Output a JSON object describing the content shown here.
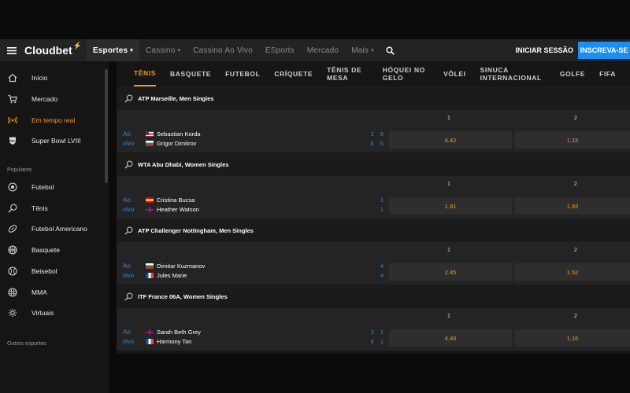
{
  "header": {
    "brand": "Cloudbet",
    "nav": [
      {
        "label": "Esportes",
        "chevron": true,
        "active": true
      },
      {
        "label": "Cassino",
        "chevron": true,
        "active": false
      },
      {
        "label": "Cassino Ao Vivo",
        "chevron": false,
        "active": false
      },
      {
        "label": "ESports",
        "chevron": false,
        "active": false
      },
      {
        "label": "Mercado",
        "chevron": false,
        "active": false
      },
      {
        "label": "Mais",
        "chevron": true,
        "active": false
      }
    ],
    "login_label": "INICIAR SESSÃO",
    "signup_label": "INSCREVA-SE"
  },
  "sidebar": {
    "top_items": [
      {
        "label": "Início",
        "icon": "home-icon"
      },
      {
        "label": "Mercado",
        "icon": "cart-icon"
      },
      {
        "label": "Em tempo real",
        "icon": "live-broadcast-icon",
        "highlight": true
      },
      {
        "label": "Super Bowl LVIII",
        "icon": "nfl-shield-icon"
      }
    ],
    "popular_heading": "Populares",
    "popular_items": [
      {
        "label": "Futebol",
        "icon": "soccer-ball-icon"
      },
      {
        "label": "Tênis",
        "icon": "tennis-racket-icon"
      },
      {
        "label": "Futebol Americano",
        "icon": "american-football-icon"
      },
      {
        "label": "Basquete",
        "icon": "basketball-icon"
      },
      {
        "label": "Beisebol",
        "icon": "baseball-icon"
      },
      {
        "label": "MMA",
        "icon": "mma-icon"
      },
      {
        "label": "Virtuais",
        "icon": "virtual-gear-icon"
      }
    ],
    "other_heading": "Outros esportes"
  },
  "tabs": [
    "TÊNIS",
    "BASQUETE",
    "FUTEBOL",
    "CRÍQUETE",
    "TÊNIS DE MESA",
    "HÓQUEI NO GELO",
    "VÔLEI",
    "SINUCA INTERNACIONAL",
    "GOLFE",
    "FIFA"
  ],
  "column_labels": {
    "home": "1",
    "away": "2"
  },
  "live_label": {
    "line1": "Ao",
    "line2": "vivo"
  },
  "events": [
    {
      "title": "ATP Marseille, Men Singles",
      "players": [
        {
          "name": "Sebastian Korda",
          "flag": "us",
          "score": "1 6"
        },
        {
          "name": "Grigor Dimitrov",
          "flag": "bg",
          "score": "6 6"
        }
      ],
      "odds": [
        "6.42",
        "1.15"
      ]
    },
    {
      "title": "WTA Abu Dhabi, Women Singles",
      "players": [
        {
          "name": "Cristina Bucsa",
          "flag": "es",
          "score": "1"
        },
        {
          "name": "Heather Watson",
          "flag": "gb",
          "score": "1"
        }
      ],
      "odds": [
        "1.91",
        "1.93"
      ]
    },
    {
      "title": "ATP Challenger Nottingham, Men Singles",
      "players": [
        {
          "name": "Dimitar Kuzmanov",
          "flag": "bg",
          "score": "4"
        },
        {
          "name": "Jules Marie",
          "flag": "fr",
          "score": "4"
        }
      ],
      "odds": [
        "2.45",
        "1.52"
      ]
    },
    {
      "title": "ITF France 06A, Women Singles",
      "players": [
        {
          "name": "Sarah Beth Grey",
          "flag": "gb",
          "score": "3 1"
        },
        {
          "name": "Harmony Tan",
          "flag": "fr",
          "score": "6 1"
        }
      ],
      "odds": [
        "4.40",
        "1.16"
      ]
    }
  ],
  "colors": {
    "accent": "#f59a1c",
    "live_blue": "#1f8fe8",
    "signup_blue": "#1b8ef2"
  }
}
